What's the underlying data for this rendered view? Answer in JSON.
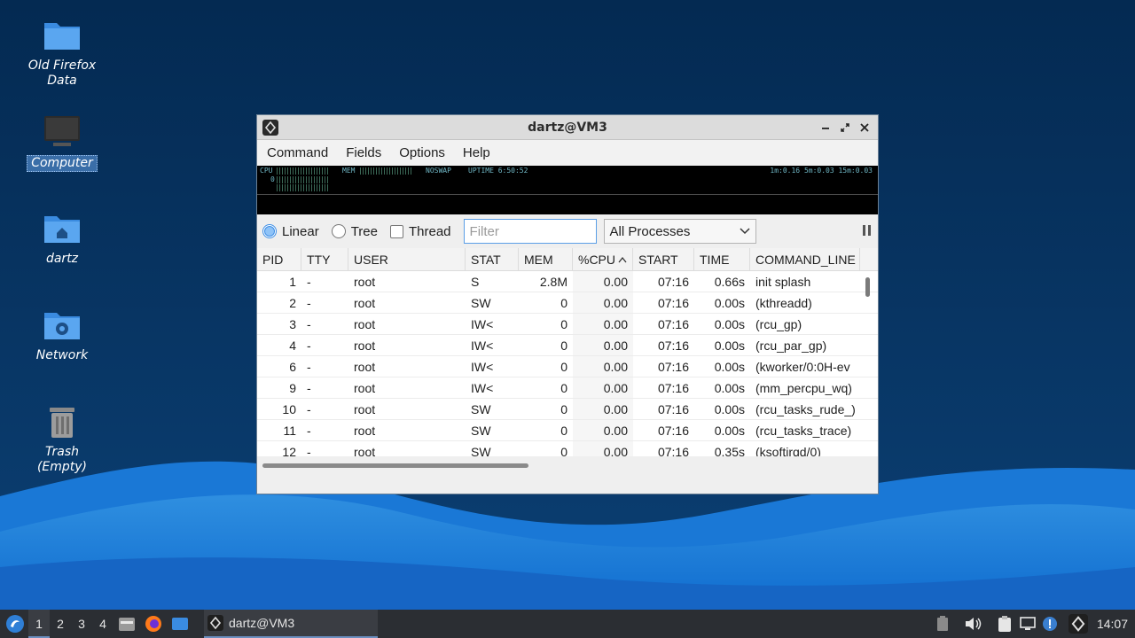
{
  "desktop": {
    "icons": [
      {
        "label": "Old Firefox Data"
      },
      {
        "label": "Computer"
      },
      {
        "label": "dartz"
      },
      {
        "label": "Network"
      },
      {
        "label": "Trash (Empty)"
      }
    ]
  },
  "window": {
    "title": "dartz@VM3",
    "menu": [
      "Command",
      "Fields",
      "Options",
      "Help"
    ],
    "meters": {
      "cpu_label": "CPU",
      "cpu_value": "0",
      "mem_label": "MEM",
      "noswap": "NOSWAP",
      "uptime": "UPTIME 6:50:52",
      "loadavg": "1m:0.16 5m:0.03 15m:0.03"
    },
    "toolbar": {
      "linear": "Linear",
      "tree": "Tree",
      "thread": "Thread",
      "filter_placeholder": "Filter",
      "process_select": "All Processes"
    },
    "table": {
      "columns": [
        "PID",
        "TTY",
        "USER",
        "STAT",
        "MEM",
        "%CPU",
        "START",
        "TIME",
        "COMMAND_LINE"
      ],
      "sorted_column": "%CPU",
      "rows": [
        [
          "1",
          "-",
          "root",
          "S",
          "2.8M",
          "0.00",
          "07:16",
          "0.66s",
          "init splash"
        ],
        [
          "2",
          "-",
          "root",
          "SW",
          "0",
          "0.00",
          "07:16",
          "0.00s",
          "(kthreadd)"
        ],
        [
          "3",
          "-",
          "root",
          "IW<",
          "0",
          "0.00",
          "07:16",
          "0.00s",
          "(rcu_gp)"
        ],
        [
          "4",
          "-",
          "root",
          "IW<",
          "0",
          "0.00",
          "07:16",
          "0.00s",
          "(rcu_par_gp)"
        ],
        [
          "6",
          "-",
          "root",
          "IW<",
          "0",
          "0.00",
          "07:16",
          "0.00s",
          "(kworker/0:0H-ev"
        ],
        [
          "9",
          "-",
          "root",
          "IW<",
          "0",
          "0.00",
          "07:16",
          "0.00s",
          "(mm_percpu_wq)"
        ],
        [
          "10",
          "-",
          "root",
          "SW",
          "0",
          "0.00",
          "07:16",
          "0.00s",
          "(rcu_tasks_rude_)"
        ],
        [
          "11",
          "-",
          "root",
          "SW",
          "0",
          "0.00",
          "07:16",
          "0.00s",
          "(rcu_tasks_trace)"
        ],
        [
          "12",
          "-",
          "root",
          "SW",
          "0",
          "0.00",
          "07:16",
          "0.35s",
          "(ksoftirqd/0)"
        ]
      ]
    }
  },
  "taskbar": {
    "workspaces": [
      "1",
      "2",
      "3",
      "4"
    ],
    "task_label": "dartz@VM3",
    "clock": "14:07"
  }
}
